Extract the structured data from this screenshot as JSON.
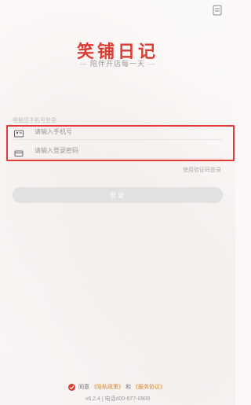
{
  "app": {
    "title": "笑铺日记",
    "subtitle": "陪伴开店每一天",
    "subtitle_dash_left": "—",
    "subtitle_dash_right": "—"
  },
  "login": {
    "hint": "根据您手机号登录",
    "phone_placeholder": "请输入手机号",
    "password_placeholder": "请输入登录密码",
    "switch_mode": "使用验证码登录",
    "submit": "登录"
  },
  "agreement": {
    "prefix": "同意",
    "privacy": "《隐私政策》",
    "and": "和",
    "service": "《服务协议》"
  },
  "footer": {
    "version_text": "v6.2.4 | 电话400-677-0909"
  },
  "colors": {
    "brand_red": "#d93d33",
    "highlight_border": "#e03a3a",
    "link_orange": "#d98a2b",
    "button_disabled": "#e1e1e1"
  },
  "icons": {
    "top_right": "document-icon",
    "phone": "id-card-icon",
    "password": "lock-icon",
    "check": "check-icon"
  }
}
